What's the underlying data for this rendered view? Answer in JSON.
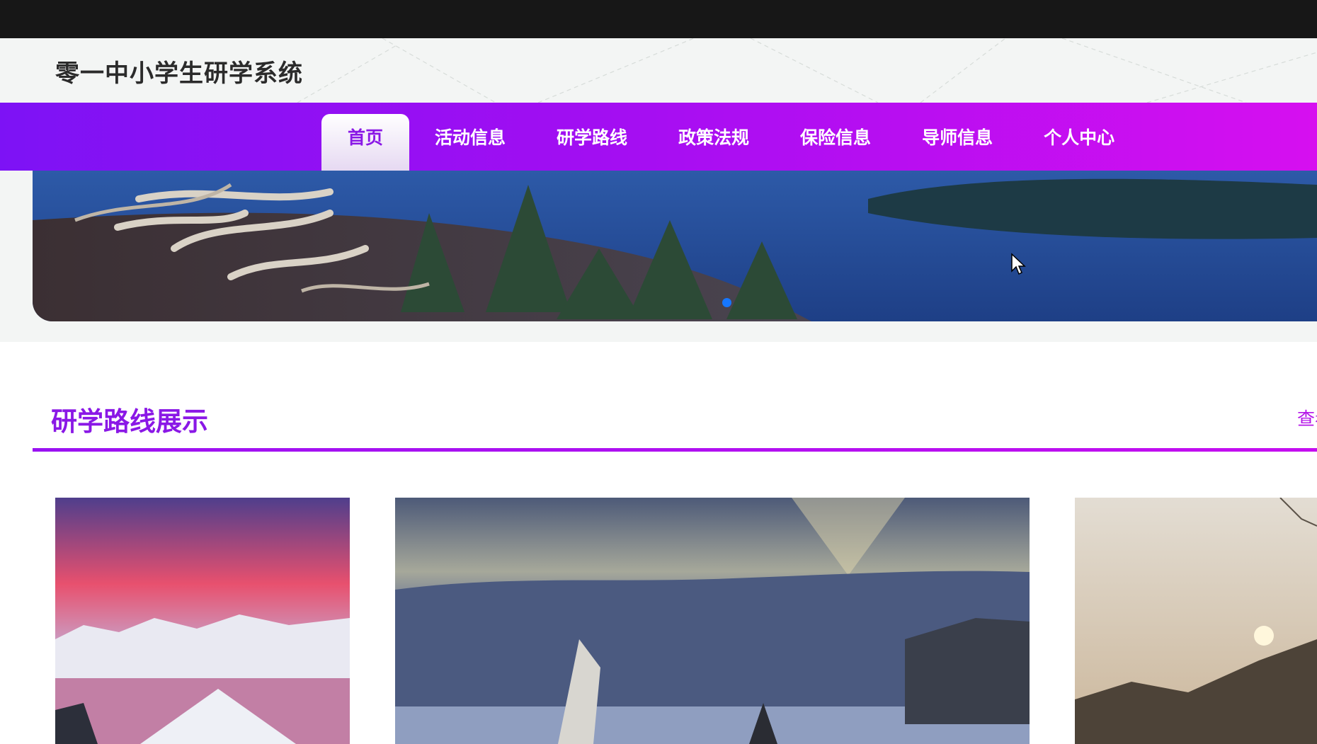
{
  "site": {
    "title": "零一中小学生研学系统"
  },
  "nav": {
    "items": [
      {
        "label": "首页",
        "active": true
      },
      {
        "label": "活动信息",
        "active": false
      },
      {
        "label": "研学路线",
        "active": false
      },
      {
        "label": "政策法规",
        "active": false
      },
      {
        "label": "保险信息",
        "active": false
      },
      {
        "label": "导师信息",
        "active": false
      },
      {
        "label": "个人中心",
        "active": false
      }
    ]
  },
  "section": {
    "title": "研学路线展示",
    "more_label": "查看更多"
  },
  "colors": {
    "accent": "#8a18e6",
    "nav_gradient_start": "#7d12f5",
    "nav_gradient_end": "#d60ff0",
    "carousel_dot": "#1677ff"
  }
}
